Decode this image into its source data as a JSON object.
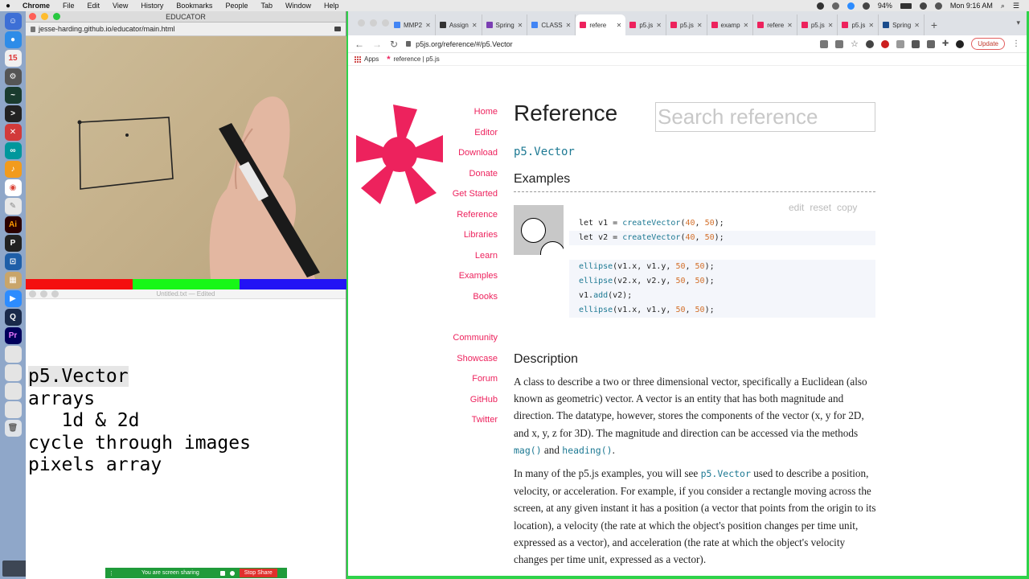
{
  "menubar": {
    "app": "Chrome",
    "items": [
      "File",
      "Edit",
      "View",
      "History",
      "Bookmarks",
      "People",
      "Tab",
      "Window",
      "Help"
    ],
    "battery": "94%",
    "clock": "Mon 9:16 AM"
  },
  "educator": {
    "title": "EDUCATOR",
    "url": "jesse-harding.github.io/educator/main.html"
  },
  "editor": {
    "title": "Untitled.txt",
    "status": "— Edited",
    "lines": [
      "p5.Vector",
      "arrays",
      "   1d & 2d",
      "cycle through images",
      "pixels array"
    ]
  },
  "sharebar": {
    "text": "You are screen sharing",
    "stop": "Stop Share"
  },
  "chrome": {
    "tabs": [
      {
        "label": "MMP2",
        "color": "#4285f4"
      },
      {
        "label": "Assign",
        "color": "#333333"
      },
      {
        "label": "Spring",
        "color": "#7b3fb3"
      },
      {
        "label": "CLASS",
        "color": "#4285f4"
      },
      {
        "label": "refere",
        "color": "#ed225d"
      },
      {
        "label": "p5.js",
        "color": "#ed225d"
      },
      {
        "label": "p5.js",
        "color": "#ed225d"
      },
      {
        "label": "examp",
        "color": "#ed225d"
      },
      {
        "label": "refere",
        "color": "#ed225d"
      },
      {
        "label": "p5.js",
        "color": "#ed225d"
      },
      {
        "label": "p5.js",
        "color": "#ed225d"
      },
      {
        "label": "Spring",
        "color": "#1a4c8c"
      }
    ],
    "url": "p5js.org/reference/#/p5.Vector",
    "update_label": "Update",
    "bookmarks": [
      {
        "label": "Apps"
      },
      {
        "label": "reference | p5.js"
      }
    ]
  },
  "page": {
    "nav_primary": [
      "Home",
      "Editor",
      "Download",
      "Donate",
      "Get Started",
      "Reference",
      "Libraries",
      "Learn",
      "Examples",
      "Books"
    ],
    "nav_secondary": [
      "Community",
      "Showcase",
      "Forum",
      "GitHub",
      "Twitter"
    ],
    "title": "Reference",
    "search_placeholder": "Search reference",
    "item_name": "p5.Vector",
    "examples_heading": "Examples",
    "example_actions": [
      "edit",
      "reset",
      "copy"
    ],
    "description_heading": "Description",
    "accent_color": "#ed225d",
    "code_color": "#1d7993"
  }
}
